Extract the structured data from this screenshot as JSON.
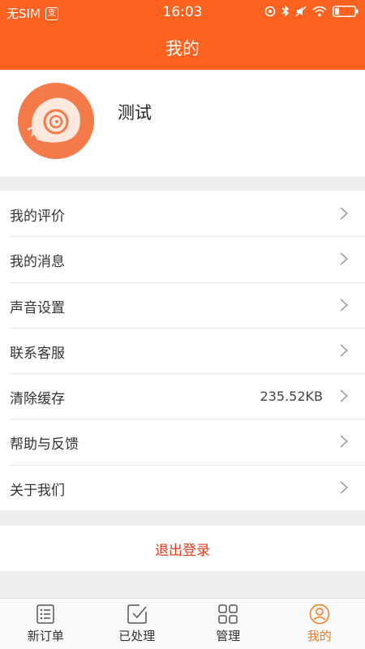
{
  "status_bar": {
    "carrier": "无SIM",
    "time": "16:03"
  },
  "nav": {
    "title": "我的"
  },
  "profile": {
    "name": "测试"
  },
  "menu": {
    "items": [
      {
        "label": "我的评价",
        "value": ""
      },
      {
        "label": "我的消息",
        "value": ""
      },
      {
        "label": "声音设置",
        "value": ""
      },
      {
        "label": "联系客服",
        "value": ""
      },
      {
        "label": "清除缓存",
        "value": "235.52KB"
      },
      {
        "label": "帮助与反馈",
        "value": ""
      },
      {
        "label": "关于我们",
        "value": ""
      }
    ]
  },
  "logout": {
    "label": "退出登录"
  },
  "tabs": [
    {
      "label": "新订单",
      "icon": "order-list-icon",
      "active": false
    },
    {
      "label": "已处理",
      "icon": "processed-icon",
      "active": false
    },
    {
      "label": "管理",
      "icon": "grid-icon",
      "active": false
    },
    {
      "label": "我的",
      "icon": "user-icon",
      "active": true
    }
  ],
  "colors": {
    "brand": "#fd6220",
    "logout": "#e03a1c",
    "tab_active": "#f4791f"
  }
}
